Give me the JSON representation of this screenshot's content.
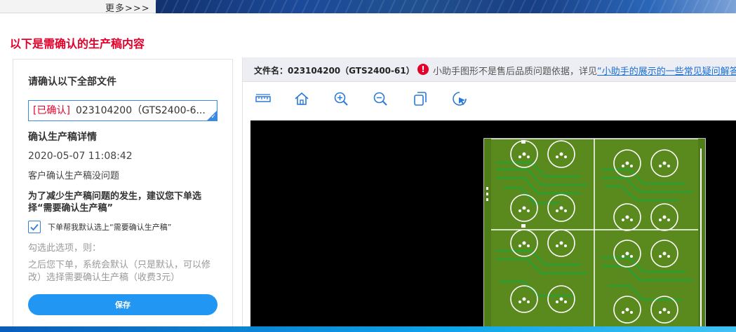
{
  "top": {
    "more_label": "更多>>>"
  },
  "section_title": "以下是需确认的生产稿内容",
  "left": {
    "heading": "请确认以下全部文件",
    "file_select": {
      "tag": "[已确认]",
      "name": "023104200（GTS2400-6..."
    },
    "detail_heading": "确认生产稿详情",
    "date": "2020-05-07 11:08:42",
    "status": "客户确认生产稿没问题",
    "advice": "为了减少生产稿问题的发生，建议您下单选择“需要确认生产稿”",
    "checkbox": {
      "checked": true,
      "label": "下单帮我默认选上“需要确认生产稿”"
    },
    "hint1": "勾选此选项，则：",
    "hint2": "之后您下单，系统会默认（只是默认，可以修改）选择需要确认生产稿（收费3元）",
    "save_label": "保存"
  },
  "right": {
    "filename_label": "文件名：023104200（GTS2400-61）",
    "warning_icon": "!",
    "warning_text": "小助手图形不是售后品质问题依据，详见",
    "warning_link": "“小助手的展示的一些常见疑问解答”",
    "toolbar": [
      {
        "icon": "ruler-icon"
      },
      {
        "icon": "home-icon"
      },
      {
        "icon": "zoom-in-icon"
      },
      {
        "icon": "zoom-out-icon"
      },
      {
        "icon": "copy-layers-icon"
      },
      {
        "icon": "pointer-select-icon"
      }
    ]
  },
  "colors": {
    "accent": "#2196f3",
    "title_red": "#e4002b",
    "pcb_green": "#5a8a1e",
    "pcb_trace": "#2f9e2f",
    "viewer_bg": "#000000"
  }
}
